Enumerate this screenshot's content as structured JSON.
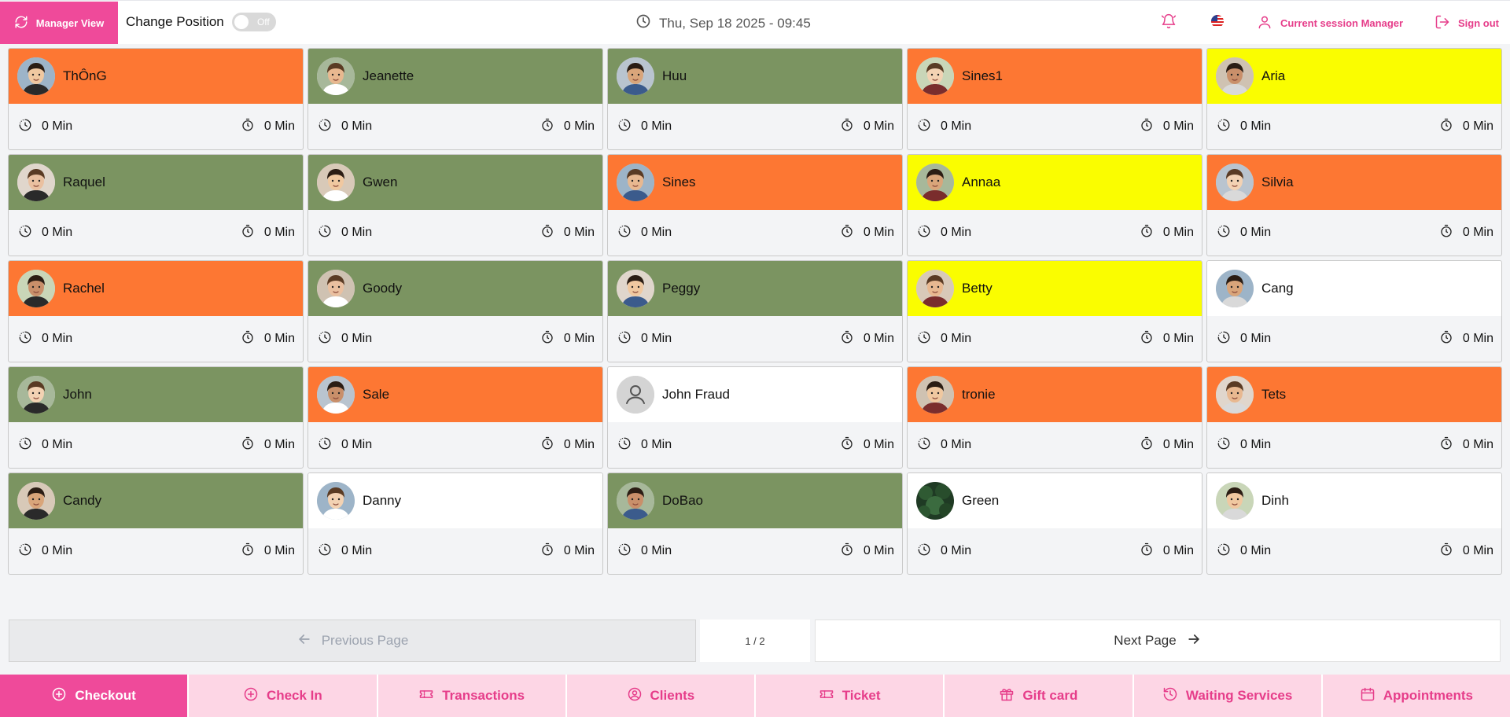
{
  "header": {
    "manager_view_label": "Manager View",
    "change_position_label": "Change Position",
    "toggle_state": "Off",
    "datetime": "Thu, Sep 18 2025 - 09:45",
    "session_label": "Current session Manager",
    "signout_label": "Sign out"
  },
  "colors": {
    "brand_pink": "#ef4a9a",
    "orange": "#fd7733",
    "green": "#7b9461",
    "yellow": "#fafd00",
    "white": "#ffffff"
  },
  "staff": [
    {
      "name": "ThÔnG",
      "color": "orange",
      "time": "0 Min",
      "timer": "0 Min"
    },
    {
      "name": "Jeanette",
      "color": "green",
      "time": "0 Min",
      "timer": "0 Min"
    },
    {
      "name": "Huu",
      "color": "green",
      "time": "0 Min",
      "timer": "0 Min"
    },
    {
      "name": "Sines1",
      "color": "orange",
      "time": "0 Min",
      "timer": "0 Min"
    },
    {
      "name": "Aria",
      "color": "yellow",
      "time": "0 Min",
      "timer": "0 Min"
    },
    {
      "name": "Raquel",
      "color": "green",
      "time": "0 Min",
      "timer": "0 Min"
    },
    {
      "name": "Gwen",
      "color": "green",
      "time": "0 Min",
      "timer": "0 Min"
    },
    {
      "name": "Sines",
      "color": "orange",
      "time": "0 Min",
      "timer": "0 Min"
    },
    {
      "name": "Annaa",
      "color": "yellow",
      "time": "0 Min",
      "timer": "0 Min"
    },
    {
      "name": "Silvia",
      "color": "orange",
      "time": "0 Min",
      "timer": "0 Min"
    },
    {
      "name": "Rachel",
      "color": "orange",
      "time": "0 Min",
      "timer": "0 Min"
    },
    {
      "name": "Goody",
      "color": "green",
      "time": "0 Min",
      "timer": "0 Min"
    },
    {
      "name": "Peggy",
      "color": "green",
      "time": "0 Min",
      "timer": "0 Min"
    },
    {
      "name": "Betty",
      "color": "yellow",
      "time": "0 Min",
      "timer": "0 Min"
    },
    {
      "name": "Cang",
      "color": "white",
      "time": "0 Min",
      "timer": "0 Min"
    },
    {
      "name": "John",
      "color": "green",
      "time": "0 Min",
      "timer": "0 Min"
    },
    {
      "name": "Sale",
      "color": "orange",
      "time": "0 Min",
      "timer": "0 Min"
    },
    {
      "name": "John Fraud",
      "color": "white",
      "time": "0 Min",
      "timer": "0 Min",
      "placeholder": true
    },
    {
      "name": "tronie",
      "color": "orange",
      "time": "0 Min",
      "timer": "0 Min"
    },
    {
      "name": "Tets",
      "color": "orange",
      "time": "0 Min",
      "timer": "0 Min"
    },
    {
      "name": "Candy",
      "color": "green",
      "time": "0 Min",
      "timer": "0 Min"
    },
    {
      "name": "Danny",
      "color": "white",
      "time": "0 Min",
      "timer": "0 Min"
    },
    {
      "name": "DoBao",
      "color": "green",
      "time": "0 Min",
      "timer": "0 Min"
    },
    {
      "name": "Green",
      "color": "white",
      "time": "0 Min",
      "timer": "0 Min"
    },
    {
      "name": "Dinh",
      "color": "white",
      "time": "0 Min",
      "timer": "0 Min"
    }
  ],
  "pagination": {
    "prev_label": "Previous Page",
    "page_info": "1 / 2",
    "next_label": "Next Page"
  },
  "bottom_nav": [
    {
      "label": "Checkout",
      "icon": "plus-circle-icon",
      "active": true
    },
    {
      "label": "Check In",
      "icon": "plus-circle-icon",
      "active": false
    },
    {
      "label": "Transactions",
      "icon": "ticket-icon",
      "active": false
    },
    {
      "label": "Clients",
      "icon": "user-circle-icon",
      "active": false
    },
    {
      "label": "Ticket",
      "icon": "ticket-icon",
      "active": false
    },
    {
      "label": "Gift card",
      "icon": "gift-icon",
      "active": false
    },
    {
      "label": "Waiting Services",
      "icon": "history-icon",
      "active": false
    },
    {
      "label": "Appointments",
      "icon": "calendar-icon",
      "active": false
    }
  ]
}
